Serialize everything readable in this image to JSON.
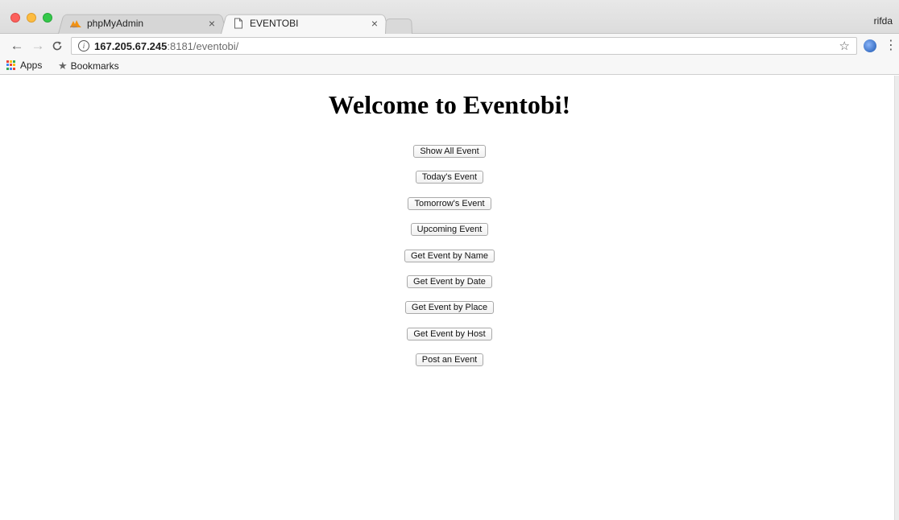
{
  "browser": {
    "tabs": [
      {
        "title": "phpMyAdmin",
        "favicon": "phpmyadmin-icon",
        "active": false
      },
      {
        "title": "EVENTOBI",
        "favicon": "document-icon",
        "active": true
      }
    ],
    "user_name": "rifda",
    "url_host": "167.205.67.245",
    "url_rest": ":8181/eventobi/",
    "bookmarks": {
      "apps_label": "Apps",
      "bookmarks_label": "Bookmarks"
    }
  },
  "page": {
    "title": "Welcome to Eventobi!",
    "buttons": [
      "Show All Event",
      "Today's Event",
      "Tomorrow's Event",
      "Upcoming Event",
      "Get Event by Name",
      "Get Event by Date",
      "Get Event by Place",
      "Get Event by Host",
      "Post an Event"
    ]
  },
  "colors": {
    "close_red": "#fc605c",
    "minimize_yellow": "#fdbc40",
    "zoom_green": "#34c84a"
  }
}
